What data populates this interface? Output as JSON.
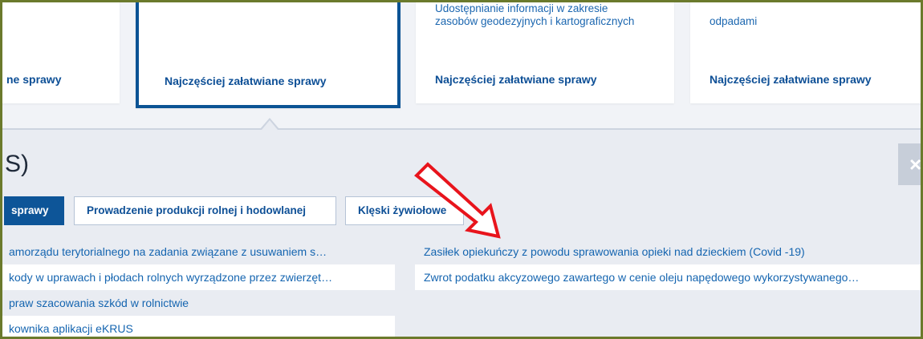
{
  "cards": [
    {
      "description": "",
      "link": "ne sprawy"
    },
    {
      "description": "",
      "link": "Najczęściej załatwiane sprawy"
    },
    {
      "description": "Udostępnianie informacji w zakresie zasobów geodezyjnych i kartograficznych",
      "link": "Najczęściej załatwiane sprawy"
    },
    {
      "description": "odpadami",
      "link": "Najczęściej załatwiane sprawy"
    }
  ],
  "panel": {
    "title": "S)",
    "close_label": "×",
    "tabs": [
      {
        "label": "sprawy",
        "active": true
      },
      {
        "label": "Prowadzenie produkcji rolnej i hodowlanej",
        "active": false
      },
      {
        "label": "Klęski żywiołowe",
        "active": false
      }
    ],
    "left_items": [
      "amorządu terytorialnego na zadania związane z usuwaniem s…",
      "kody w uprawach i płodach rolnych wyrządzone przez zwierzęt…",
      "praw szacowania szkód w rolnictwie",
      "kownika aplikacji eKRUS"
    ],
    "right_items": [
      "Zasiłek opiekuńczy z powodu sprawowania opieki nad dzieckiem (Covid -19)",
      "Zwrot podatku akcyzowego zawartego w cenie oleju napędowego wykorzystywanego…"
    ]
  },
  "annotation": {
    "icon": "red-arrow-icon",
    "color": "#e8141c"
  },
  "colors": {
    "accent": "#0d5598",
    "link": "#1565b0",
    "frame": "#6b7a2c"
  }
}
